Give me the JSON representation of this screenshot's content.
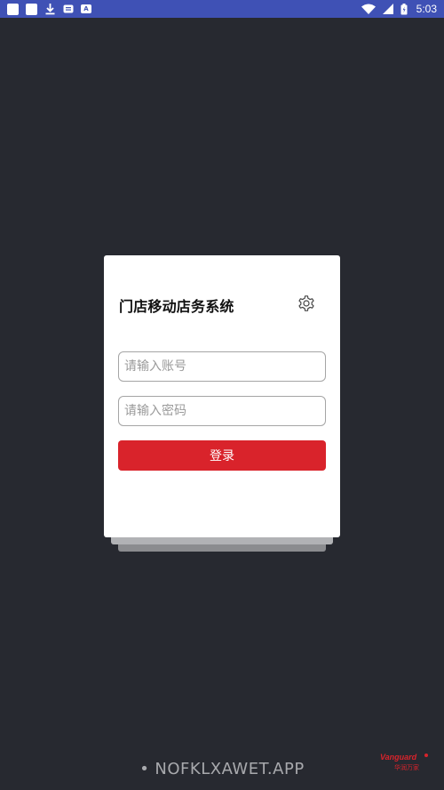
{
  "status_bar": {
    "time": "5:03",
    "left_icons": [
      "square-icon",
      "square-icon",
      "download-icon",
      "notification-icon",
      "a-icon"
    ],
    "a_icon_label": "A",
    "right_icons": [
      "wifi-icon",
      "signal-icon",
      "battery-icon"
    ],
    "color": "#3f51b5"
  },
  "login_card": {
    "title": "门店移动店务系统",
    "settings_icon": "gear-icon",
    "account_placeholder": "请输入账号",
    "password_placeholder": "请输入密码",
    "login_label": "登录",
    "accent_color": "#d9232b"
  },
  "footer": {
    "bullet": "•",
    "text": "NOFKLXAWET.APP",
    "brand_name": "Vanguard",
    "brand_sub": "华润万家"
  },
  "colors": {
    "background": "#272930",
    "card": "#ffffff",
    "button": "#d9232b"
  }
}
